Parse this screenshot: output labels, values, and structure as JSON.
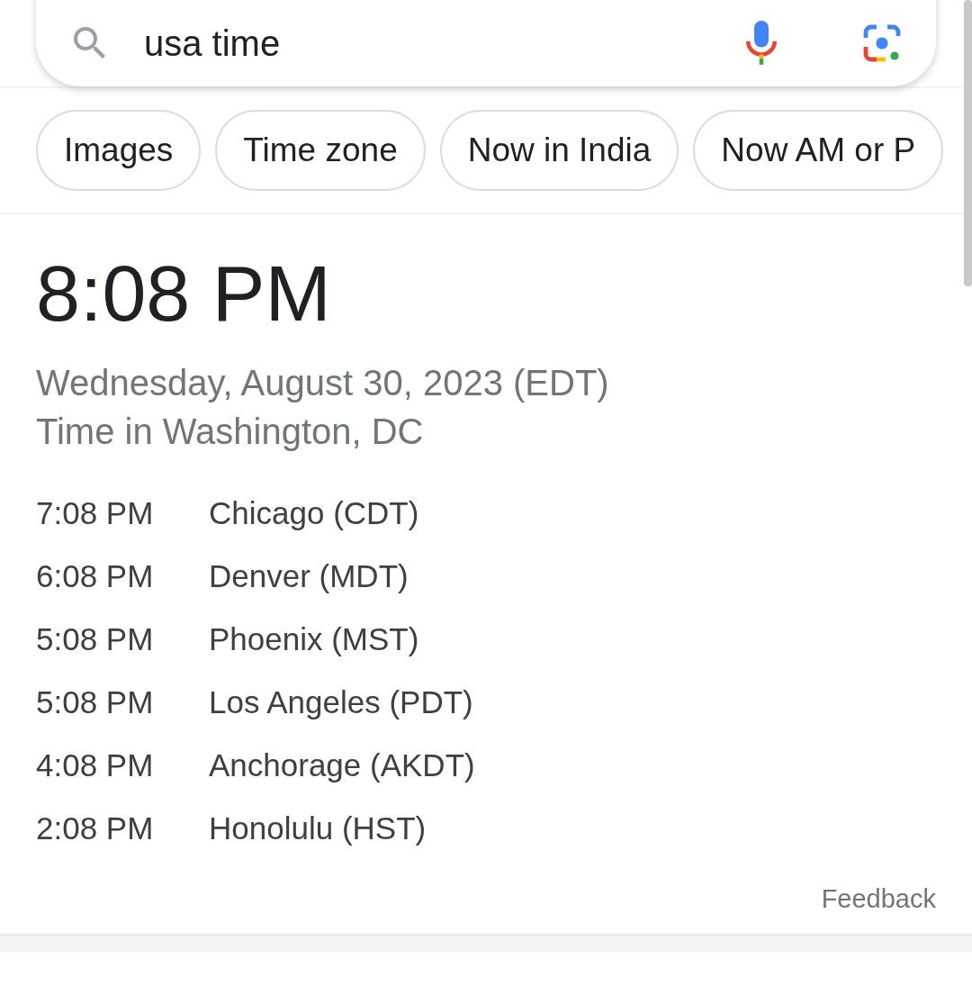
{
  "search": {
    "value": "usa time"
  },
  "chips": [
    {
      "label": "Images"
    },
    {
      "label": "Time zone"
    },
    {
      "label": "Now in India"
    },
    {
      "label": "Now AM or P"
    }
  ],
  "clock": {
    "time": "8:08 PM",
    "date": "Wednesday, August 30, 2023 (EDT)",
    "place": "Time in Washington, DC"
  },
  "zones": [
    {
      "time": "7:08 PM",
      "city": "Chicago (CDT)"
    },
    {
      "time": "6:08 PM",
      "city": "Denver (MDT)"
    },
    {
      "time": "5:08 PM",
      "city": "Phoenix (MST)"
    },
    {
      "time": "5:08 PM",
      "city": "Los Angeles (PDT)"
    },
    {
      "time": "4:08 PM",
      "city": "Anchorage (AKDT)"
    },
    {
      "time": "2:08 PM",
      "city": "Honolulu (HST)"
    }
  ],
  "feedback": "Feedback"
}
